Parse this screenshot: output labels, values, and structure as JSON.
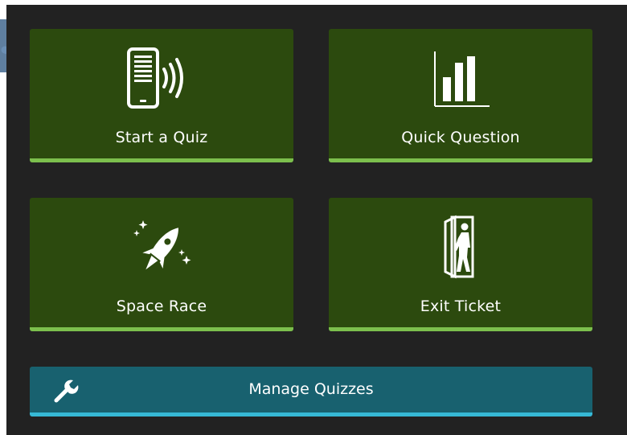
{
  "tiles": {
    "start_quiz": {
      "label": "Start a Quiz",
      "icon": "tablet-broadcast-icon"
    },
    "quick_question": {
      "label": "Quick Question",
      "icon": "bar-chart-icon"
    },
    "space_race": {
      "label": "Space Race",
      "icon": "rocket-icon"
    },
    "exit_ticket": {
      "label": "Exit Ticket",
      "icon": "exit-door-icon"
    }
  },
  "manage": {
    "label": "Manage Quizzes",
    "icon": "wrench-icon"
  },
  "colors": {
    "tile_bg": "#2c4a0e",
    "tile_accent": "#7cbf4d",
    "manage_bg": "#18616f",
    "manage_accent": "#36b9d6",
    "panel_bg": "#222222",
    "callout_arrow": "#6b8fb5"
  }
}
